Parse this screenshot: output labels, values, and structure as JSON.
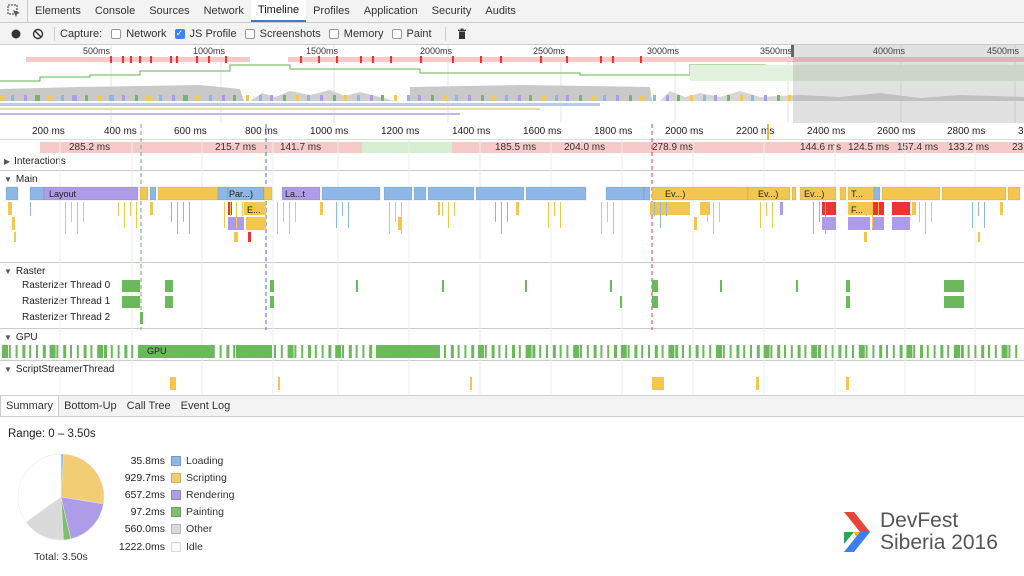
{
  "tabs": [
    "Elements",
    "Console",
    "Sources",
    "Network",
    "Timeline",
    "Profiles",
    "Application",
    "Security",
    "Audits"
  ],
  "active_tab": "Timeline",
  "toolbar": {
    "capture_label": "Capture:",
    "options": [
      {
        "label": "Network",
        "checked": false
      },
      {
        "label": "JS Profile",
        "checked": true
      },
      {
        "label": "Screenshots",
        "checked": false
      },
      {
        "label": "Memory",
        "checked": false
      },
      {
        "label": "Paint",
        "checked": false
      }
    ]
  },
  "overview_ticks": [
    "500ms",
    "1000ms",
    "1500ms",
    "2000ms",
    "2500ms",
    "3000ms",
    "3500ms",
    "4000ms",
    "4500ms"
  ],
  "ruler_ticks": [
    "200 ms",
    "400 ms",
    "600 ms",
    "800 ms",
    "1000 ms",
    "1200 ms",
    "1400 ms",
    "1600 ms",
    "1800 ms",
    "2000 ms",
    "2200 ms",
    "2400 ms",
    "2600 ms",
    "2800 ms",
    "3"
  ],
  "frame_durations": [
    "285.2 ms",
    "215.7 ms",
    "141.7 ms",
    "185.5 ms",
    "204.0 ms",
    "278.9 ms",
    "144.6 ms",
    "124.5 ms",
    "157.4 ms",
    "133.2 ms",
    "23"
  ],
  "tracks": {
    "interactions": "Interactions",
    "main": "Main",
    "raster": "Raster",
    "rasterizer_threads": [
      "Rasterizer Thread 0",
      "Rasterizer Thread 1",
      "Rasterizer Thread 2"
    ],
    "gpu": "GPU",
    "gpu_event": "GPU",
    "script_streamer": "ScriptStreamerThread"
  },
  "main_events": {
    "layout": "Layout",
    "parse": "Par...)",
    "e": "E...",
    "la": "La...t",
    "ev1": "Ev...)",
    "ev2": "Ev...)",
    "ev3": "Ev...)",
    "t": "T...",
    "f": "F..."
  },
  "bottom_tabs": [
    "Summary",
    "Bottom-Up",
    "Call Tree",
    "Event Log"
  ],
  "summary": {
    "range": "Range: 0 – 3.50s",
    "total": "Total: 3.50s",
    "categories": [
      {
        "name": "Loading",
        "value": "35.8ms",
        "ms": 35.8,
        "color": "#8eb6e6"
      },
      {
        "name": "Scripting",
        "value": "929.7ms",
        "ms": 929.7,
        "color": "#f2cd73"
      },
      {
        "name": "Rendering",
        "value": "657.2ms",
        "ms": 657.2,
        "color": "#ae9ce8"
      },
      {
        "name": "Painting",
        "value": "97.2ms",
        "ms": 97.2,
        "color": "#7dbf6e"
      },
      {
        "name": "Other",
        "value": "560.0ms",
        "ms": 560.0,
        "color": "#dadada"
      },
      {
        "name": "Idle",
        "value": "1222.0ms",
        "ms": 1222.0,
        "color": "#ffffff"
      }
    ]
  },
  "logo": {
    "line1": "DevFest",
    "line2": "Siberia 2016"
  }
}
